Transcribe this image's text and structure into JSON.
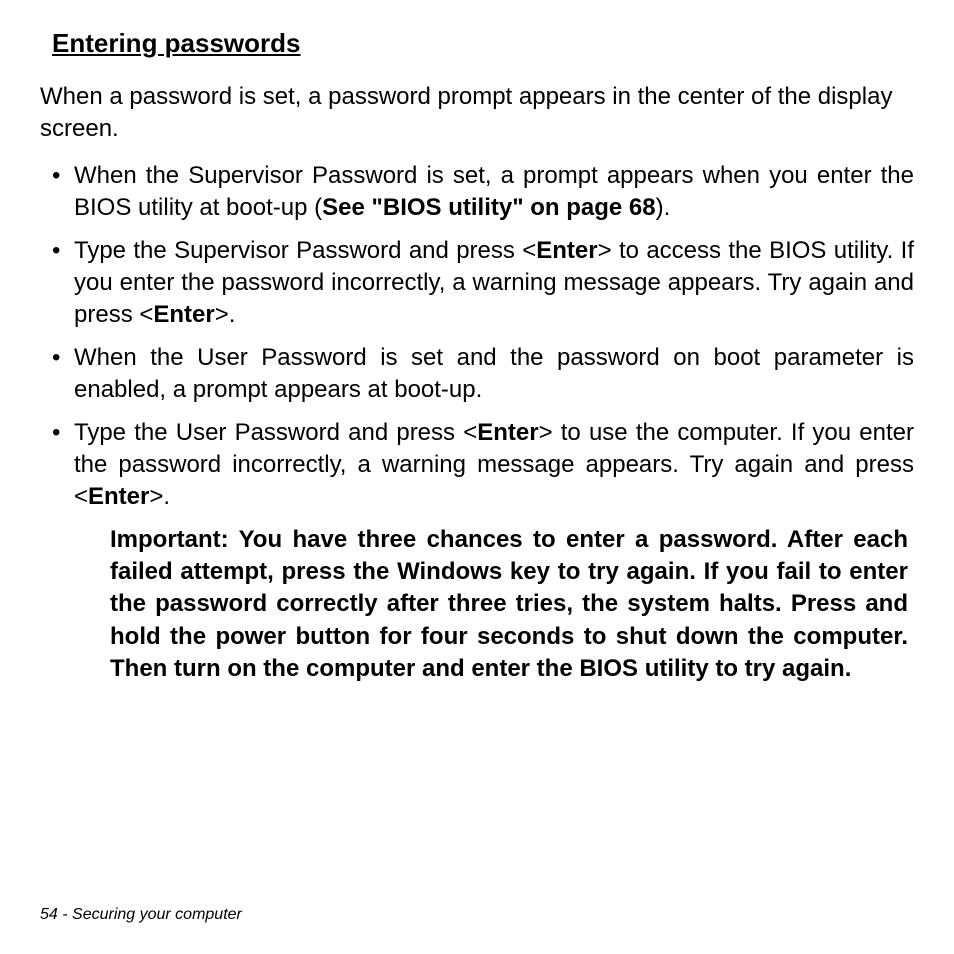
{
  "heading": "Entering passwords",
  "intro": "When a password is set, a password prompt appears in the center of the display screen.",
  "bullets": [
    {
      "pre": "When the Supervisor Password is set, a prompt appears when you enter the BIOS utility at boot-up (",
      "bold1": "See \"BIOS utility\" on page 68",
      "post": ")."
    },
    {
      "pre": "Type the Supervisor Password and press <",
      "bold1": "Enter",
      "mid": "> to access the BIOS utility. If you enter the password incorrectly, a warning message appears. Try again and press <",
      "bold2": "Enter",
      "post": ">."
    },
    {
      "pre": "When the User Password is set and the password on boot parameter is enabled, a prompt appears at boot-up."
    },
    {
      "pre": "Type the User Password and press <",
      "bold1": "Enter",
      "mid": "> to use the computer. If you enter the password incorrectly, a warning message appears. Try again and press <",
      "bold2": "Enter",
      "post": ">."
    }
  ],
  "note": "Important: You have three chances to enter a password. After each failed attempt, press the Windows key to try again. If you fail to enter the password correctly after three tries, the system halts. Press and hold the power button for four seconds to shut down the computer. Then turn on the computer and enter the BIOS utility to try again.",
  "footer_page": "54 - ",
  "footer_title": "Securing your computer"
}
